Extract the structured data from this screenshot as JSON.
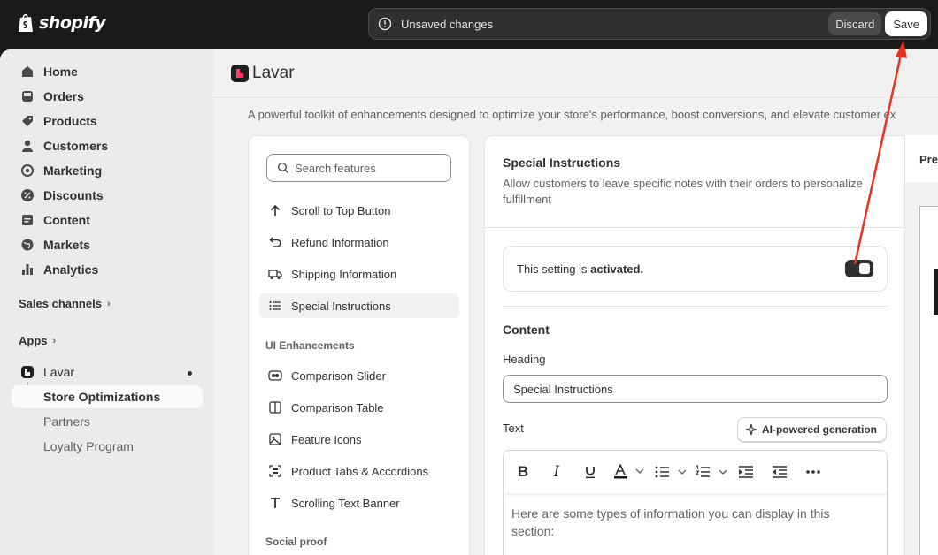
{
  "topbar": {
    "brand": "shopify",
    "unsaved_message": "Unsaved changes",
    "discard_label": "Discard",
    "save_label": "Save"
  },
  "sidebar": {
    "items": [
      {
        "label": "Home",
        "icon": "home-icon"
      },
      {
        "label": "Orders",
        "icon": "orders-icon"
      },
      {
        "label": "Products",
        "icon": "tag-icon"
      },
      {
        "label": "Customers",
        "icon": "person-icon"
      },
      {
        "label": "Marketing",
        "icon": "target-icon"
      },
      {
        "label": "Discounts",
        "icon": "discount-icon"
      },
      {
        "label": "Content",
        "icon": "content-icon"
      },
      {
        "label": "Markets",
        "icon": "globe-icon"
      },
      {
        "label": "Analytics",
        "icon": "bar-chart-icon"
      }
    ],
    "sales_channels": "Sales channels",
    "apps": "Apps",
    "app_name": "Lavar",
    "sub_items": [
      "Store Optimizations",
      "Partners",
      "Loyalty Program"
    ]
  },
  "main": {
    "app_title": "Lavar",
    "description": "A powerful toolkit of enhancements designed to optimize your store's performance, boost conversions, and elevate customer ex",
    "search_placeholder": "Search features",
    "features": [
      {
        "label": "Scroll to Top Button",
        "icon": "arrow-up-icon"
      },
      {
        "label": "Refund Information",
        "icon": "return-icon"
      },
      {
        "label": "Shipping Information",
        "icon": "truck-icon"
      },
      {
        "label": "Special Instructions",
        "icon": "list-icon"
      }
    ],
    "category_ui": "UI Enhancements",
    "ui_features": [
      {
        "label": "Comparison Slider",
        "icon": "slider-icon"
      },
      {
        "label": "Comparison Table",
        "icon": "table-columns-icon"
      },
      {
        "label": "Feature Icons",
        "icon": "image-icon"
      },
      {
        "label": "Product Tabs & Accordions",
        "icon": "tabs-icon"
      },
      {
        "label": "Scrolling Text Banner",
        "icon": "text-icon"
      }
    ],
    "category_social": "Social proof"
  },
  "settings": {
    "title": "Special Instructions",
    "description": "Allow customers to leave specific notes with their orders to personalize fulfillment",
    "status_prefix": "This setting is ",
    "status_value": "activated.",
    "toggle_on": true,
    "content_heading": "Content",
    "heading_label": "Heading",
    "heading_value": "Special Instructions",
    "text_label": "Text",
    "ai_button": "AI-powered generation",
    "editor_text": "Here are some types of information you can display in this section:"
  },
  "preview": {
    "tab_label": "Pre"
  },
  "colors": {
    "annotation_arrow": "#e8321e",
    "topbar_bg": "#1a1a1a",
    "toggle_bg": "#303030"
  }
}
